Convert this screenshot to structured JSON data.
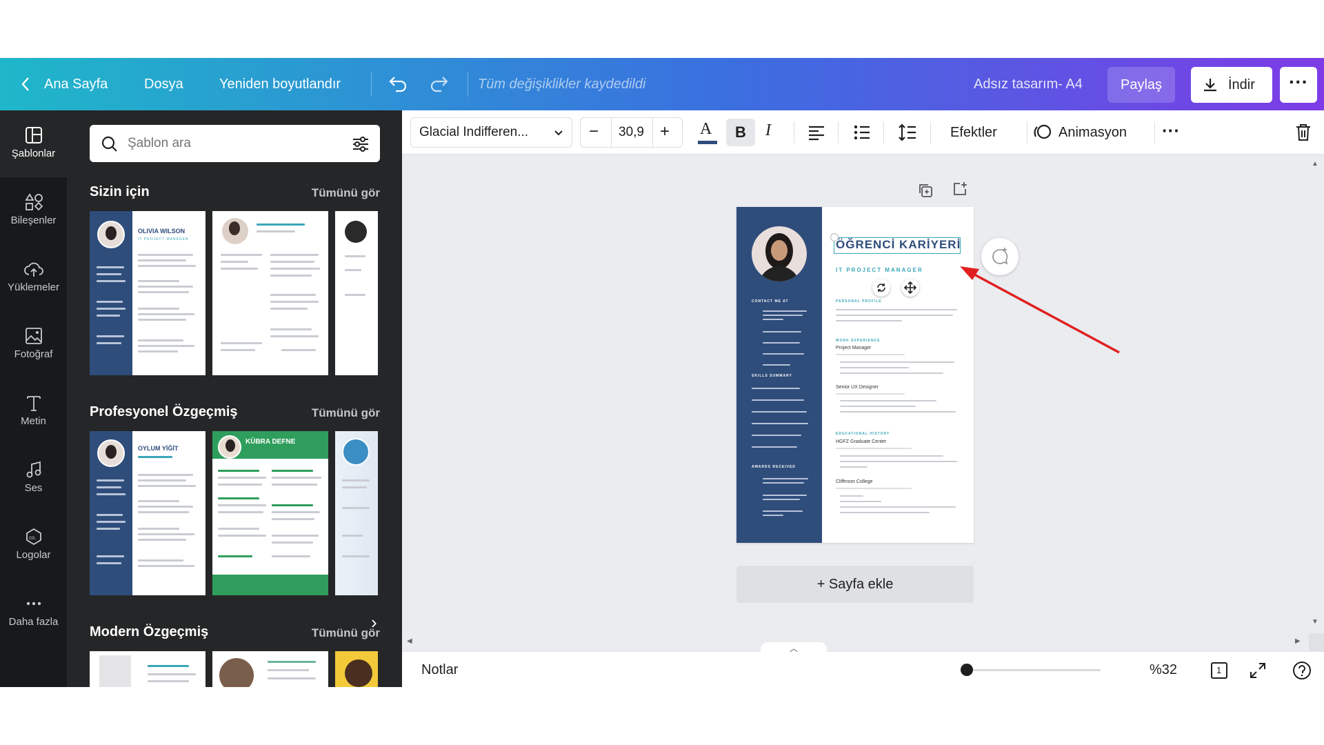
{
  "topbar": {
    "home_label": "Ana Sayfa",
    "file_label": "Dosya",
    "resize_label": "Yeniden boyutlandır",
    "save_status": "Tüm değişiklikler kaydedildi",
    "design_title": "Adsız tasarım- A4",
    "share_label": "Paylaş",
    "download_label": "İndir"
  },
  "rail": [
    {
      "label": "Şablonlar",
      "icon": "templates-icon"
    },
    {
      "label": "Bileşenler",
      "icon": "elements-icon"
    },
    {
      "label": "Yüklemeler",
      "icon": "upload-cloud-icon"
    },
    {
      "label": "Fotoğraf",
      "icon": "photo-icon"
    },
    {
      "label": "Metin",
      "icon": "text-icon"
    },
    {
      "label": "Ses",
      "icon": "music-icon"
    },
    {
      "label": "Logolar",
      "icon": "logo-icon"
    },
    {
      "label": "Daha fazla",
      "icon": "more-dots-icon"
    }
  ],
  "panel": {
    "search_placeholder": "Şablon ara",
    "sections": [
      {
        "title": "Sizin için",
        "see_all": "Tümünü gör",
        "thumbs": [
          {
            "name": "OLIVIA WILSON",
            "role": "IT PROJECT MANAGER"
          }
        ]
      },
      {
        "title": "Profesyonel Özgeçmiş",
        "see_all": "Tümünü gör",
        "thumbs": [
          {
            "name": "OYLUM YİĞİT",
            "role": ""
          },
          {
            "name": "KÜBRA DEFNE",
            "role": ""
          }
        ]
      },
      {
        "title": "Modern Özgeçmiş",
        "see_all": "Tümünü gör"
      }
    ]
  },
  "toolbar": {
    "font_family": "Glacial Indifferen...",
    "font_size": "30,9",
    "effects_label": "Efektler",
    "animation_label": "Animasyon"
  },
  "resume": {
    "title": "ÖĞRENCİ KARİYERİ",
    "subtitle": "IT PROJECT MANAGER",
    "contact_heading": "CONTACT ME AT",
    "skills_heading": "SKILLS SUMMARY",
    "awards_heading": "AWARDS RECEIVED",
    "profile_heading": "PERSONAL PROFILE",
    "work_heading": "WORK EXPERIENCE",
    "job1": "Project Manager",
    "job2": "Senior UX Designer",
    "edu_heading": "EDUCATIONAL HISTORY",
    "school1": "HGFZ Graduate Center",
    "school2": "Cliffmoor College"
  },
  "add_page_label": "+ Sayfa ekle",
  "bottombar": {
    "notes_label": "Notlar",
    "zoom_label": "%32",
    "page_count": "1",
    "zoom_level": 0.32
  },
  "colors": {
    "resume_sidebar": "#2f4d7b",
    "resume_accent": "#3aa6b9",
    "arrow": "#e02020"
  }
}
